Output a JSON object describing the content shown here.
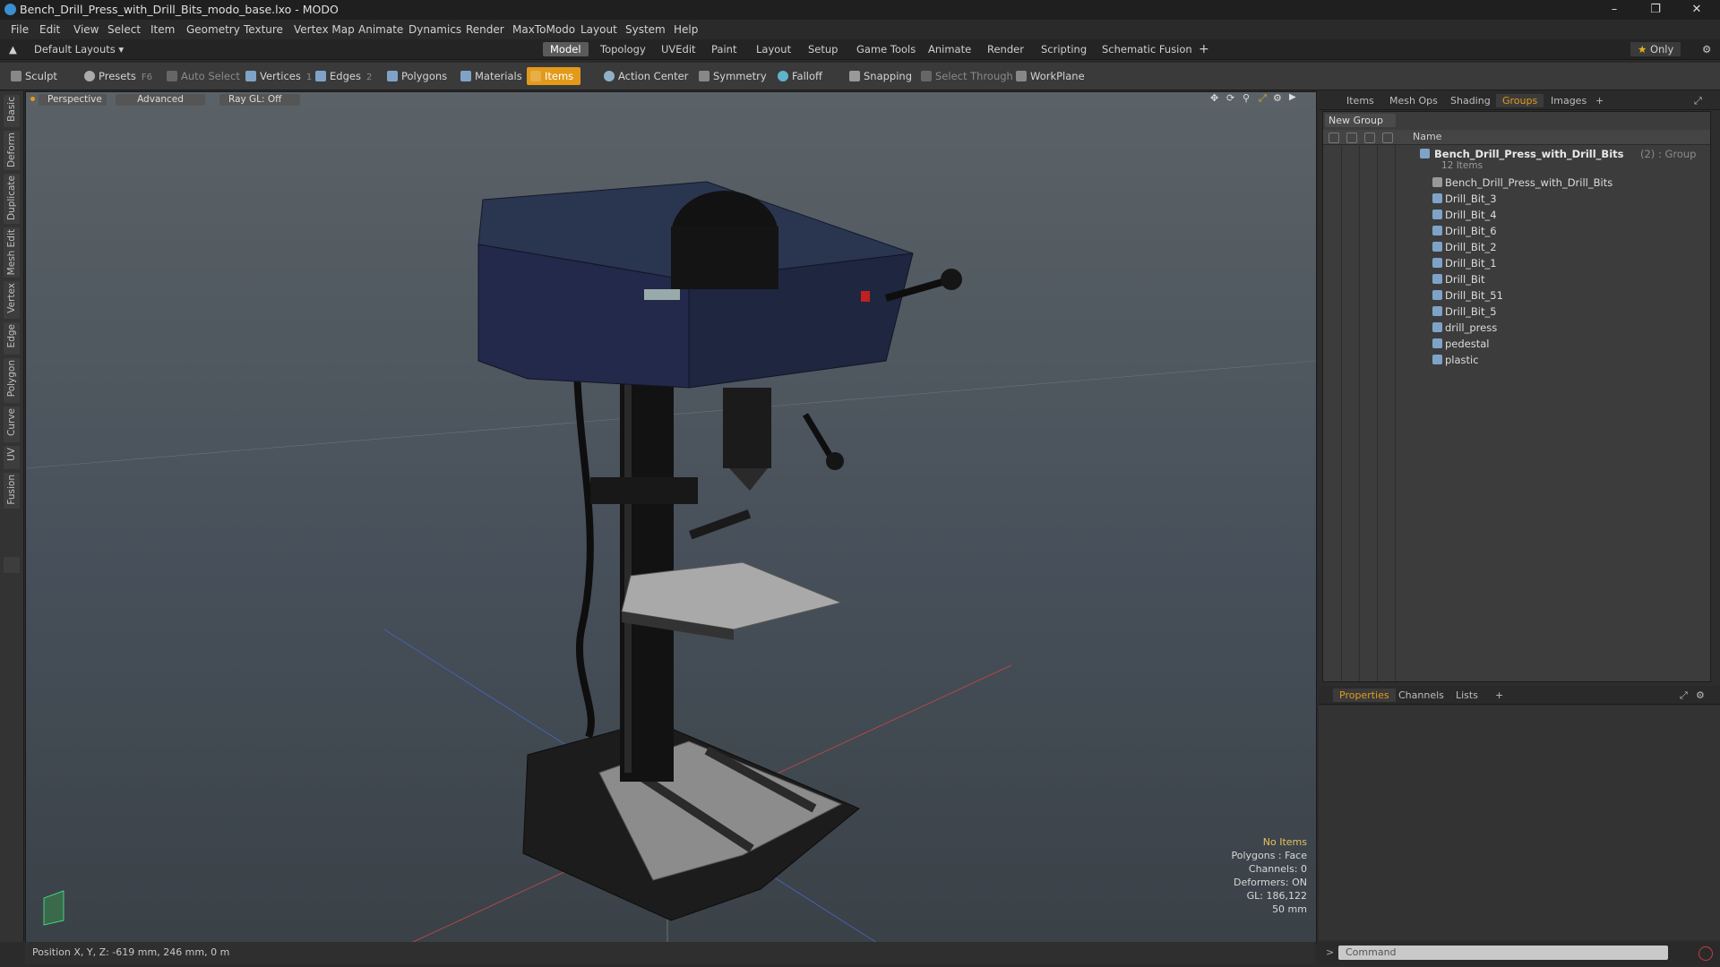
{
  "window": {
    "title": "Bench_Drill_Press_with_Drill_Bits_modo_base.lxo - MODO"
  },
  "menu": [
    "File",
    "Edit",
    "View",
    "Select",
    "Item",
    "Geometry",
    "Texture",
    "Vertex Map",
    "Animate",
    "Dynamics",
    "Render",
    "MaxToModo",
    "Layout",
    "System",
    "Help"
  ],
  "layouts": {
    "default": "Default Layouts",
    "tabs": [
      "Model",
      "Topology",
      "UVEdit",
      "Paint",
      "Layout",
      "Setup",
      "Game Tools",
      "Animate",
      "Render",
      "Scripting",
      "Schematic Fusion"
    ],
    "active": "Model",
    "only": "Only"
  },
  "toolbar": {
    "sculpt": "Sculpt",
    "presets": "Presets",
    "presets_key": "F6",
    "auto_select": "Auto Select",
    "vertices": "Vertices",
    "vertices_count": "1",
    "edges": "Edges",
    "edges_count": "2",
    "polygons": "Polygons",
    "materials": "Materials",
    "items": "Items",
    "action_center": "Action Center",
    "symmetry": "Symmetry",
    "falloff": "Falloff",
    "snapping": "Snapping",
    "select_through": "Select Through",
    "workplane": "WorkPlane"
  },
  "left_tabs": [
    "Basic",
    "Deform",
    "Duplicate",
    "Mesh Edit",
    "Vertex",
    "Edge",
    "Polygon",
    "Curve",
    "UV",
    "Fusion"
  ],
  "viewport": {
    "perspective": "Perspective",
    "advanced": "Advanced",
    "raygl": "Ray GL: Off",
    "info": {
      "items": "No Items",
      "polygons": "Polygons : Face",
      "channels": "Channels: 0",
      "deformers": "Deformers: ON",
      "gl": "GL: 186,122",
      "scale": "50 mm"
    }
  },
  "status": {
    "position": "Position X, Y, Z:  -619 mm, 246 mm, 0 m"
  },
  "panels": {
    "top_tabs": [
      "Items",
      "Mesh Ops",
      "Shading",
      "Groups",
      "Images"
    ],
    "top_active": "Groups",
    "new_group": "New Group",
    "name_header": "Name",
    "group": {
      "name": "Bench_Drill_Press_with_Drill_Bits",
      "suffix": "(2) : Group",
      "count": "12 Items"
    },
    "items": [
      "Bench_Drill_Press_with_Drill_Bits",
      "Drill_Bit_3",
      "Drill_Bit_4",
      "Drill_Bit_6",
      "Drill_Bit_2",
      "Drill_Bit_1",
      "Drill_Bit",
      "Drill_Bit_51",
      "Drill_Bit_5",
      "drill_press",
      "pedestal",
      "plastic"
    ],
    "bottom_tabs": [
      "Properties",
      "Channels",
      "Lists"
    ],
    "bottom_active": "Properties"
  },
  "command": {
    "placeholder": "Command"
  },
  "colors": {
    "accent": "#e39a1a",
    "viewport_top": "#5b6267",
    "viewport_bottom": "#3a4147",
    "press_body": "#2a3550"
  },
  "icons": [
    "app-icon",
    "minimize-icon",
    "maximize-icon",
    "close-icon",
    "star-icon",
    "gear-icon",
    "cube-icon",
    "eye-icon",
    "lock-icon",
    "plus-icon"
  ]
}
